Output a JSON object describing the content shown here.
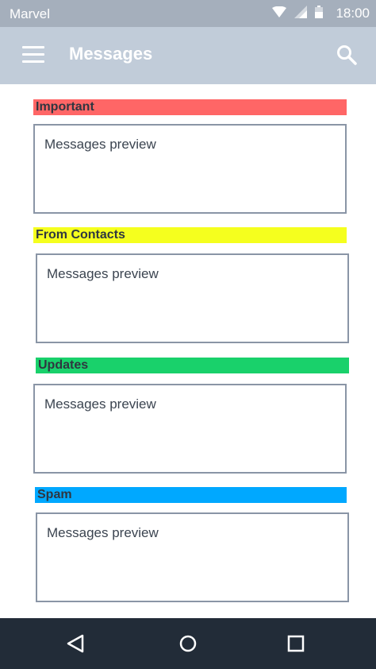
{
  "status_bar": {
    "carrier": "Marvel",
    "time": "18:00",
    "icons": [
      "wifi-icon",
      "signal-icon",
      "battery-icon"
    ]
  },
  "app_bar": {
    "title": "Messages",
    "menu_icon": "hamburger-menu-icon",
    "search_icon": "search-icon"
  },
  "categories": [
    {
      "label": "Important",
      "color": "#ff6666",
      "preview": "Messages preview"
    },
    {
      "label": "From Contacts",
      "color": "#f5ff1e",
      "preview": "Messages preview"
    },
    {
      "label": "Updates",
      "color": "#19d16b",
      "preview": "Messages preview"
    },
    {
      "label": "Spam",
      "color": "#00a8ff",
      "preview": "Messages preview"
    }
  ],
  "nav_bar": {
    "icons": [
      "back-icon",
      "home-icon",
      "recents-icon"
    ]
  }
}
